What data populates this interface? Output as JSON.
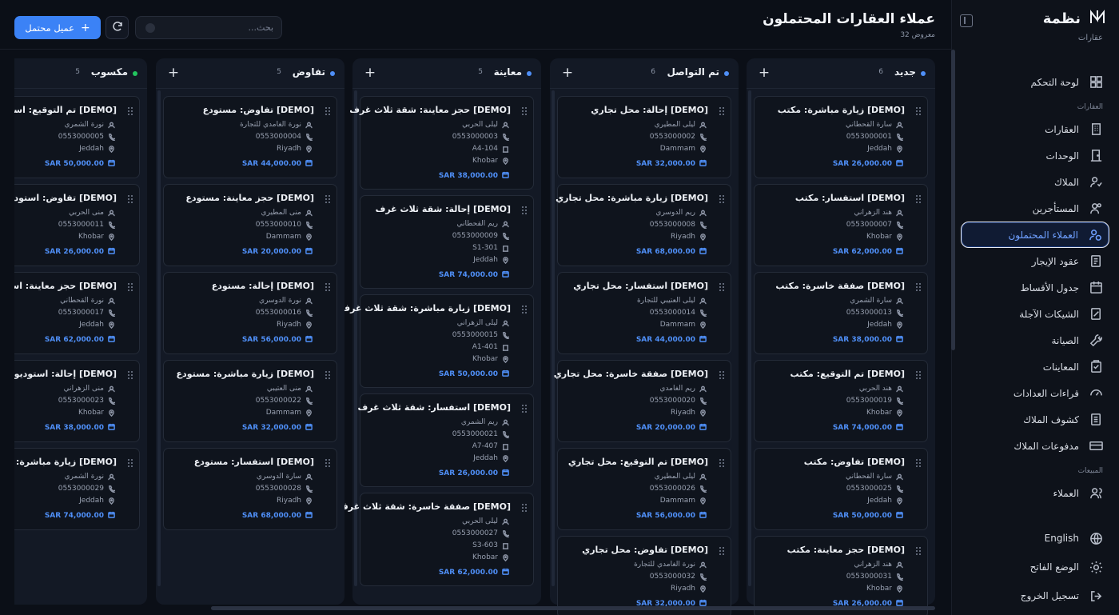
{
  "brand": {
    "name": "نظمة",
    "subtitle": "عقارات"
  },
  "header": {
    "title": "عملاء العقارات المحتملون",
    "subtitle": "معروض 32",
    "add_button": "عميل محتمل",
    "search_placeholder": "بحث..."
  },
  "sidebar": {
    "top_item": {
      "label": "لوحة التحكم",
      "icon": "dashboard-icon"
    },
    "section_realestate": "العقارات",
    "items": [
      {
        "label": "العقارات",
        "icon": "building-icon"
      },
      {
        "label": "الوحدات",
        "icon": "door-icon"
      },
      {
        "label": "الملاك",
        "icon": "owners-icon"
      },
      {
        "label": "المستأجرين",
        "icon": "tenants-icon"
      },
      {
        "label": "العملاء المحتملون",
        "icon": "leads-icon",
        "active": true
      },
      {
        "label": "عقود الإيجار",
        "icon": "contract-icon"
      },
      {
        "label": "جدول الأقساط",
        "icon": "calendar-icon"
      },
      {
        "label": "الشيكات الآجلة",
        "icon": "cheque-icon"
      },
      {
        "label": "الصيانة",
        "icon": "wrench-icon"
      },
      {
        "label": "المعاينات",
        "icon": "clipboard-icon"
      },
      {
        "label": "قراءات العدادات",
        "icon": "gauge-icon"
      },
      {
        "label": "كشوف الملاك",
        "icon": "statement-icon"
      },
      {
        "label": "مدفوعات الملاك",
        "icon": "card-icon"
      }
    ],
    "section_sales": "المبيعات",
    "sales_items": [
      {
        "label": "العملاء",
        "icon": "users-icon"
      }
    ],
    "bottom": [
      {
        "label": "English",
        "icon": "globe-icon"
      },
      {
        "label": "الوضع الفاتح",
        "icon": "sun-icon"
      },
      {
        "label": "تسجيل الخروج",
        "icon": "logout-icon"
      }
    ]
  },
  "colors": {
    "accent": "#3b82f6",
    "price": "#4f8ff7",
    "won": "#22c55e"
  },
  "columns": [
    {
      "title": "جديد",
      "count": "6",
      "dot": "#4f8ff7",
      "cards": [
        {
          "title": "[DEMO] زيارة مباشرة: مكتب",
          "name": "سارة القحطاني",
          "phone": "0553000001",
          "unit": "",
          "city": "Jeddah",
          "price": "SAR 26,000.00"
        },
        {
          "title": "[DEMO] استفسار: مكتب",
          "name": "هند الزهراني",
          "phone": "0553000007",
          "unit": "",
          "city": "Khobar",
          "price": "SAR 62,000.00"
        },
        {
          "title": "[DEMO] صفقة خاسرة: مكتب",
          "name": "سارة الشمري",
          "phone": "0553000013",
          "unit": "",
          "city": "Jeddah",
          "price": "SAR 38,000.00"
        },
        {
          "title": "[DEMO] تم التوقيع: مكتب",
          "name": "هند الحربي",
          "phone": "0553000019",
          "unit": "",
          "city": "Khobar",
          "price": "SAR 74,000.00"
        },
        {
          "title": "[DEMO] تفاوض: مكتب",
          "name": "سارة القحطاني",
          "phone": "0553000025",
          "unit": "",
          "city": "Jeddah",
          "price": "SAR 50,000.00"
        },
        {
          "title": "[DEMO] حجز معاينة: مكتب",
          "name": "هند الزهراني",
          "phone": "0553000031",
          "unit": "",
          "city": "Khobar",
          "price": "SAR 26,000.00"
        }
      ]
    },
    {
      "title": "تم التواصل",
      "count": "6",
      "dot": "#4f8ff7",
      "cards": [
        {
          "title": "[DEMO] إحالة: محل تجاري",
          "name": "ليلى المطيري",
          "phone": "0553000002",
          "unit": "",
          "city": "Dammam",
          "price": "SAR 32,000.00"
        },
        {
          "title": "[DEMO] زيارة مباشرة: محل تجاري",
          "name": "ريم الدوسري",
          "phone": "0553000008",
          "unit": "",
          "city": "Riyadh",
          "price": "SAR 68,000.00"
        },
        {
          "title": "[DEMO] استفسار: محل تجاري",
          "name": "ليلى العتيبي للتجارة",
          "phone": "0553000014",
          "unit": "",
          "city": "Dammam",
          "price": "SAR 44,000.00"
        },
        {
          "title": "[DEMO] صفقة خاسرة: محل تجاري",
          "name": "ريم الغامدي",
          "phone": "0553000020",
          "unit": "",
          "city": "Riyadh",
          "price": "SAR 20,000.00"
        },
        {
          "title": "[DEMO] تم التوقيع: محل تجاري",
          "name": "ليلى المطيري",
          "phone": "0553000026",
          "unit": "",
          "city": "Dammam",
          "price": "SAR 56,000.00"
        },
        {
          "title": "[DEMO] تفاوض: محل تجاري",
          "name": "نورة الغامدي للتجارة",
          "phone": "0553000032",
          "unit": "",
          "city": "Riyadh",
          "price": "SAR 32,000.00"
        }
      ]
    },
    {
      "title": "معاينة",
      "count": "5",
      "dot": "#4f8ff7",
      "cards": [
        {
          "title": "[DEMO] حجز معاينة: شقة ثلاث غرف",
          "name": "ليلى الحربي",
          "phone": "0553000003",
          "unit": "A4-104",
          "city": "Khobar",
          "price": "SAR 38,000.00"
        },
        {
          "title": "[DEMO] إحالة: شقة ثلاث غرف",
          "name": "ريم القحطاني",
          "phone": "0553000009",
          "unit": "S1-301",
          "city": "Jeddah",
          "price": "SAR 74,000.00"
        },
        {
          "title": "[DEMO] زيارة مباشرة: شقة ثلاث غرف",
          "name": "ليلى الزهراني",
          "phone": "0553000015",
          "unit": "A1-401",
          "city": "Khobar",
          "price": "SAR 50,000.00"
        },
        {
          "title": "[DEMO] استفسار: شقة ثلاث غرف",
          "name": "ريم الشمري",
          "phone": "0553000021",
          "unit": "A7-407",
          "city": "Jeddah",
          "price": "SAR 26,000.00"
        },
        {
          "title": "[DEMO] صفقة خاسرة: شقة ثلاث غرف",
          "name": "ليلى الحربي",
          "phone": "0553000027",
          "unit": "S3-603",
          "city": "Khobar",
          "price": "SAR 62,000.00"
        }
      ]
    },
    {
      "title": "تفاوض",
      "count": "5",
      "dot": "#4f8ff7",
      "cards": [
        {
          "title": "[DEMO] تفاوض: مستودع",
          "name": "نورة الغامدي للتجارة",
          "phone": "0553000004",
          "unit": "",
          "city": "Riyadh",
          "price": "SAR 44,000.00"
        },
        {
          "title": "[DEMO] حجز معاينة: مستودع",
          "name": "منى المطيري",
          "phone": "0553000010",
          "unit": "",
          "city": "Dammam",
          "price": "SAR 20,000.00"
        },
        {
          "title": "[DEMO] إحالة: مستودع",
          "name": "نورة الدوسري",
          "phone": "0553000016",
          "unit": "",
          "city": "Riyadh",
          "price": "SAR 56,000.00"
        },
        {
          "title": "[DEMO] زيارة مباشرة: مستودع",
          "name": "منى العتيبي",
          "phone": "0553000022",
          "unit": "",
          "city": "Dammam",
          "price": "SAR 32,000.00"
        },
        {
          "title": "[DEMO] استفسار: مستودع",
          "name": "سارة الدوسري",
          "phone": "0553000028",
          "unit": "",
          "city": "Riyadh",
          "price": "SAR 68,000.00"
        }
      ]
    },
    {
      "title": "مكسوب",
      "count": "5",
      "dot": "#22c55e",
      "cards": [
        {
          "title": "[DEMO] تم التوقيع: استوديو",
          "name": "نورة الشمري",
          "phone": "0553000005",
          "unit": "",
          "city": "Jeddah",
          "price": "SAR 50,000.00"
        },
        {
          "title": "[DEMO] تفاوض: استوديو",
          "name": "منى الحربي",
          "phone": "0553000011",
          "unit": "",
          "city": "Khobar",
          "price": "SAR 26,000.00"
        },
        {
          "title": "[DEMO] حجز معاينة: استوديو",
          "name": "نورة القحطاني",
          "phone": "0553000017",
          "unit": "",
          "city": "Jeddah",
          "price": "SAR 62,000.00"
        },
        {
          "title": "[DEMO] إحالة: استوديو",
          "name": "منى الزهراني",
          "phone": "0553000023",
          "unit": "",
          "city": "Khobar",
          "price": "SAR 38,000.00"
        },
        {
          "title": "[DEMO] زيارة مباشرة: استوديو",
          "name": "نورة الشمري",
          "phone": "0553000029",
          "unit": "",
          "city": "Jeddah",
          "price": "SAR 74,000.00"
        }
      ]
    }
  ]
}
